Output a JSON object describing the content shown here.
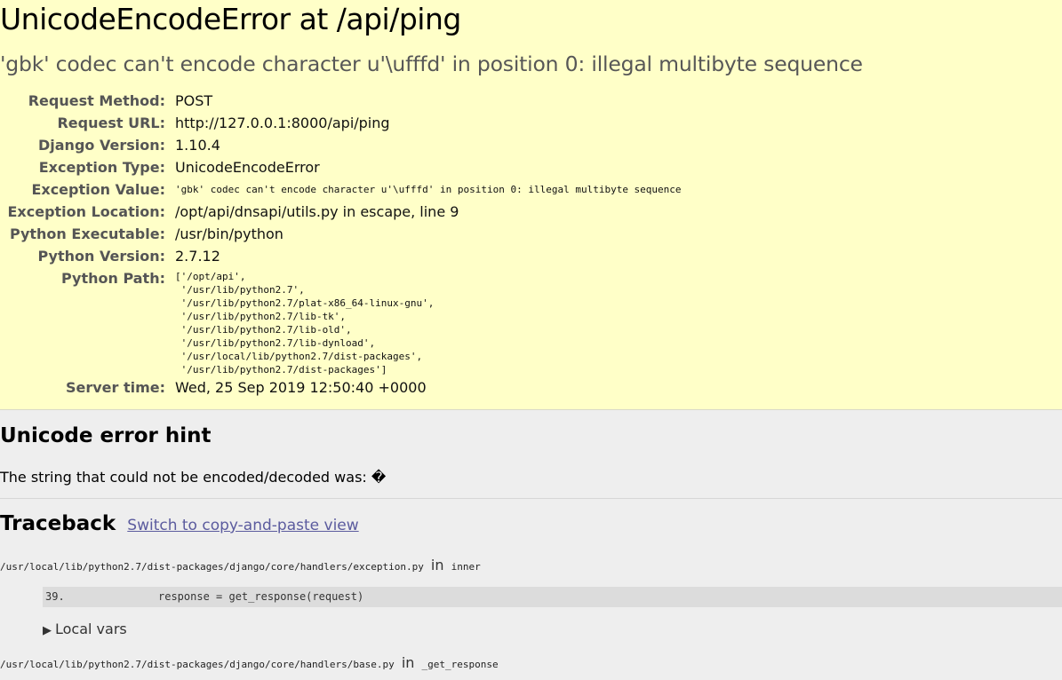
{
  "summary": {
    "title": "UnicodeEncodeError at /api/ping",
    "subtitle": "'gbk' codec can't encode character u'\\ufffd' in position 0: illegal multibyte sequence",
    "rows": [
      {
        "label": "Request Method:",
        "value": "POST"
      },
      {
        "label": "Request URL:",
        "value": "http://127.0.0.1:8000/api/ping"
      },
      {
        "label": "Django Version:",
        "value": "1.10.4"
      },
      {
        "label": "Exception Type:",
        "value": "UnicodeEncodeError"
      },
      {
        "label": "Exception Value:",
        "value": "'gbk' codec can't encode character u'\\ufffd' in position 0: illegal multibyte sequence"
      },
      {
        "label": "Exception Location:",
        "value": "/opt/api/dnsapi/utils.py in escape, line 9"
      },
      {
        "label": "Python Executable:",
        "value": "/usr/bin/python"
      },
      {
        "label": "Python Version:",
        "value": "2.7.12"
      },
      {
        "label": "Python Path:",
        "value": "['/opt/api',\n '/usr/lib/python2.7',\n '/usr/lib/python2.7/plat-x86_64-linux-gnu',\n '/usr/lib/python2.7/lib-tk',\n '/usr/lib/python2.7/lib-old',\n '/usr/lib/python2.7/lib-dynload',\n '/usr/local/lib/python2.7/dist-packages',\n '/usr/lib/python2.7/dist-packages']"
      },
      {
        "label": "Server time:",
        "value": "Wed, 25 Sep 2019 12:50:40 +0000"
      }
    ]
  },
  "unicode_hint": {
    "heading": "Unicode error hint",
    "text": "The string that could not be encoded/decoded was: �"
  },
  "traceback": {
    "heading": "Traceback",
    "switch_link": "Switch to copy-and-paste view",
    "in_word": "in",
    "frames": [
      {
        "file": "/usr/local/lib/python2.7/dist-packages/django/core/handlers/exception.py",
        "function": "inner",
        "lineno": "39.",
        "code": "response = get_response(request)",
        "local_vars_label": "Local vars"
      },
      {
        "file": "/usr/local/lib/python2.7/dist-packages/django/core/handlers/base.py",
        "function": "_get_response"
      }
    ]
  },
  "colors": {
    "summary_bg": "#ffffc8",
    "page_bg": "#eeeeee",
    "link": "#5b5b9e",
    "context_line_bg": "#dcdcdc"
  }
}
